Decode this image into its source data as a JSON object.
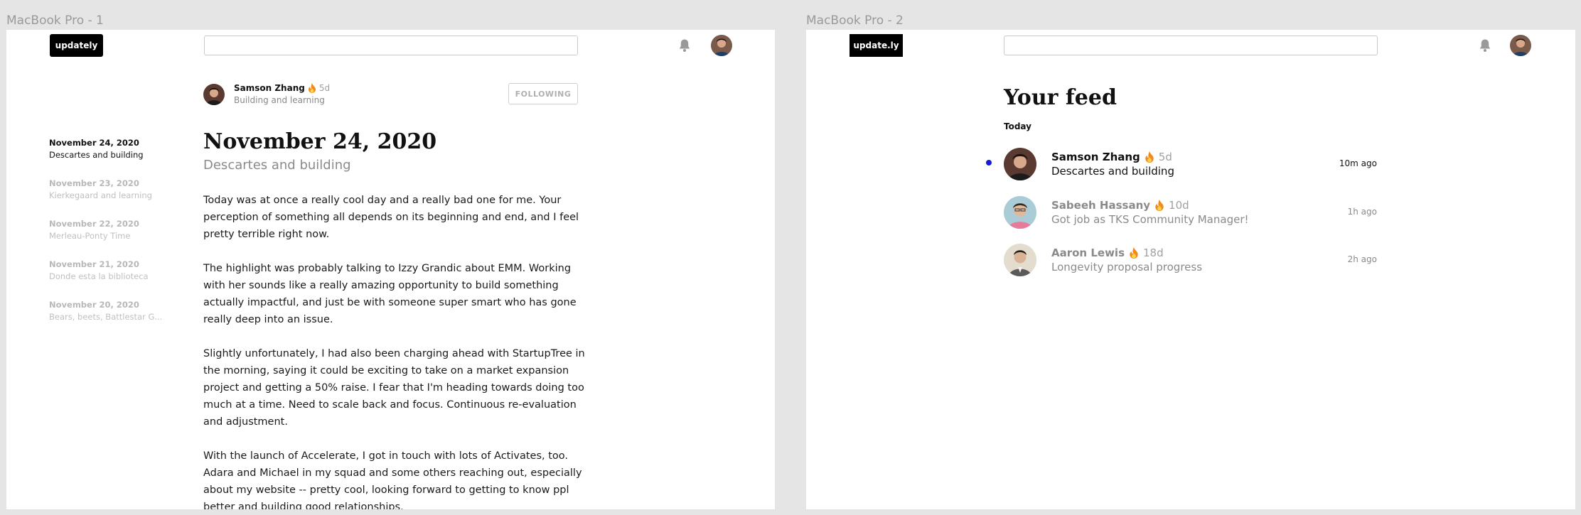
{
  "frames": [
    {
      "label": "MacBook Pro - 1",
      "logo": "updately",
      "search": {
        "value": "",
        "placeholder": ""
      },
      "post": {
        "author": "Samson Zhang",
        "streak_icon": "fire-icon",
        "streak": "5d",
        "bio": "Building and learning",
        "follow_label": "FOLLOWING",
        "title": "November 24, 2020",
        "subtitle": "Descartes and building",
        "paragraphs": [
          "Today was at once a really cool day and a really bad one for me. Your perception of something all depends on its beginning and end, and I feel pretty terrible right now.",
          "The highlight was probably talking to Izzy Grandic about EMM. Working with her sounds like a really amazing opportunity to build something actually impactful, and just be with someone super smart who has gone really deep into an issue.",
          "Slightly unfortunately, I had also been charging ahead with StartupTree in the morning, saying it could be exciting to take on a market expansion project and getting a 50% raise. I fear that I'm heading towards doing too much at a time. Need to scale back and focus. Continuous re-evaluation and adjustment.",
          "With the launch of Accelerate, I got in touch with lots of Activates, too. Adara and Michael in my squad and some others reaching out, especially about my website -- pretty cool, looking forward to getting to know ppl better and building good relationships."
        ]
      },
      "toc": [
        {
          "date": "November 24, 2020",
          "title": "Descartes and building",
          "active": true
        },
        {
          "date": "November 23, 2020",
          "title": "Kierkegaard and learning",
          "active": false
        },
        {
          "date": "November 22, 2020",
          "title": "Merleau-Ponty Time",
          "active": false
        },
        {
          "date": "November 21, 2020",
          "title": "Donde esta la biblioteca",
          "active": false
        },
        {
          "date": "November 20, 2020",
          "title": "Bears, beets, Battlestar G...",
          "active": false
        }
      ]
    },
    {
      "label": "MacBook Pro - 2",
      "logo": "update.ly",
      "search": {
        "value": "",
        "placeholder": ""
      },
      "feed_title": "Your feed",
      "section": "Today",
      "items": [
        {
          "name": "Samson Zhang",
          "streak": "5d",
          "title": "Descartes and building",
          "time": "10m ago",
          "unread": true
        },
        {
          "name": "Sabeeh Hassany",
          "streak": "10d",
          "title": "Got job as TKS Community Manager!",
          "time": "1h ago",
          "unread": false
        },
        {
          "name": "Aaron Lewis",
          "streak": "18d",
          "title": "Longevity proposal progress",
          "time": "2h ago",
          "unread": false
        }
      ]
    }
  ],
  "colors": {
    "unread_dot": "#1a1ad6",
    "fire": "#f08a1c",
    "logo_bg": "#000000"
  }
}
